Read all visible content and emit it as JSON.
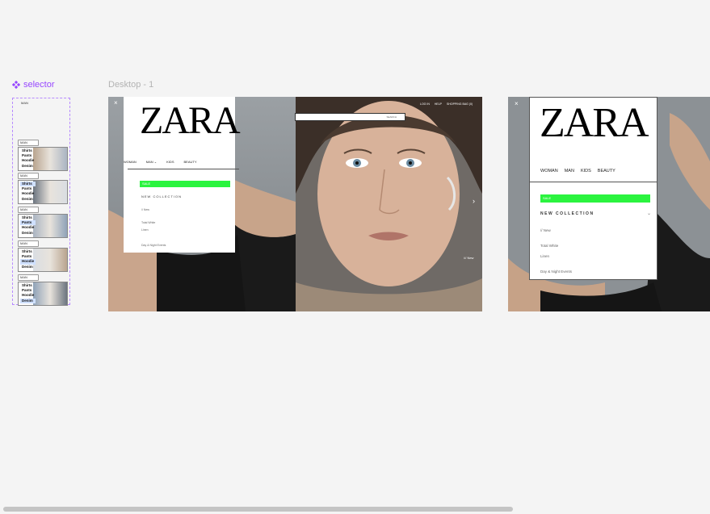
{
  "component": {
    "name": "selector",
    "icon": "component-icon",
    "top_label": "MAN"
  },
  "variants": [
    {
      "pill": "MAN",
      "items": [
        "Shirts",
        "Pants",
        "Hoodie",
        "Denim"
      ],
      "highlight": -1
    },
    {
      "pill": "MAN",
      "items": [
        "Shirts",
        "Pants",
        "Hoodie",
        "Denim"
      ],
      "highlight": 0
    },
    {
      "pill": "MAN",
      "items": [
        "Shirts",
        "Pants",
        "Hoodie",
        "Denim"
      ],
      "highlight": 1
    },
    {
      "pill": "MAN",
      "items": [
        "Shirts",
        "Pants",
        "Hoodie",
        "Denim"
      ],
      "highlight": 2
    },
    {
      "pill": "MAN",
      "items": [
        "Shirts",
        "Pants",
        "Hoodie",
        "Denim"
      ],
      "highlight": 3
    }
  ],
  "frame": {
    "label": "Desktop - 1",
    "logo": "ZARA",
    "close": "×",
    "tabs": [
      "WOMAN",
      "MAN",
      "KIDS",
      "BEAUTY"
    ],
    "sale": "SALE",
    "new_collection": "NEW COLLECTION",
    "links": [
      "// New",
      "Total White",
      "Linen",
      "Day & Night Events"
    ],
    "search": "SEARCH",
    "top_links": [
      "LOG IN",
      "HELP",
      "SHOPPING BAG (0)"
    ],
    "badge": "/// New",
    "arrow": "›"
  },
  "frame2": {
    "logo": "ZARA",
    "close": "×",
    "tabs": [
      "WOMAN",
      "MAN",
      "KIDS",
      "BEAUTY"
    ],
    "sale": "SALE",
    "new_collection": "NEW COLLECTION",
    "links": [
      "// New",
      "Total White",
      "Linen",
      "Day & Night Events"
    ]
  },
  "colors": {
    "component": "#9747ff",
    "sale": "#2bf43f",
    "canvas": "#f4f4f4"
  }
}
